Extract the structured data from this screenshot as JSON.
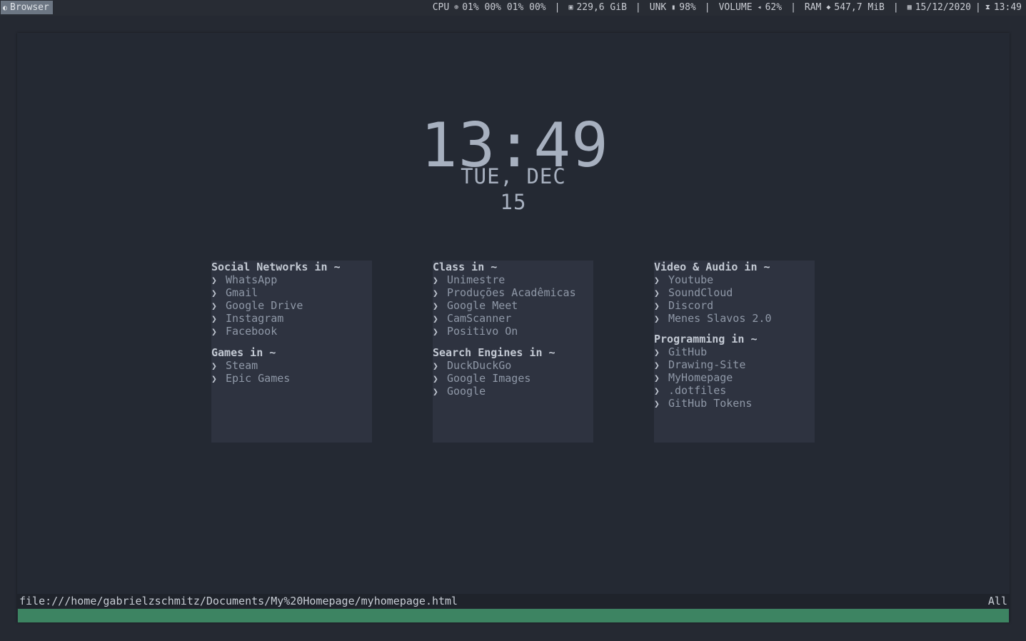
{
  "topbar": {
    "workspace_label": "Browser",
    "workspace_icon": "ws-icon",
    "cpu_label": "CPU",
    "cpu_values": "01% 00% 01% 00%",
    "disk_value": "229,6 GiB",
    "battery_label": "UNK",
    "battery_value": "98%",
    "volume_label": "VOLUME",
    "volume_value": "62%",
    "ram_label": "RAM",
    "ram_value": "547,7 MiB",
    "date_value": "15/12/2020",
    "time_value": "13:49",
    "separator": "|"
  },
  "clock": {
    "time": "13:49",
    "date": "TUE, DEC 15"
  },
  "panels": [
    {
      "groups": [
        {
          "title": "Social Networks in ~",
          "links": [
            "WhatsApp",
            "Gmail",
            "Google Drive",
            "Instagram",
            "Facebook"
          ]
        },
        {
          "title": "Games in ~",
          "links": [
            "Steam",
            "Epic Games"
          ]
        }
      ]
    },
    {
      "groups": [
        {
          "title": "Class in ~",
          "links": [
            "Unimestre",
            "Produções Acadêmicas",
            "Google Meet",
            "CamScanner",
            "Positivo On"
          ]
        },
        {
          "title": "Search Engines in ~",
          "links": [
            "DuckDuckGo",
            "Google Images",
            "Google"
          ]
        }
      ]
    },
    {
      "groups": [
        {
          "title": "Video & Audio in ~",
          "links": [
            "Youtube",
            "SoundCloud",
            "Discord",
            "Menes Slavos 2.0"
          ]
        },
        {
          "title": "Programming in ~",
          "links": [
            "GitHub",
            "Drawing-Site",
            "MyHomepage",
            ".dotfiles",
            "GitHub Tokens"
          ]
        }
      ]
    }
  ],
  "link_marker": "❯",
  "statusbar": {
    "url": "file:///home/gabrielzschmitz/Documents/My%20Homepage/myhomepage.html",
    "scroll": "All"
  },
  "colors": {
    "progress": "#3d8462",
    "background": "#242933",
    "panel": "#2e3340"
  }
}
